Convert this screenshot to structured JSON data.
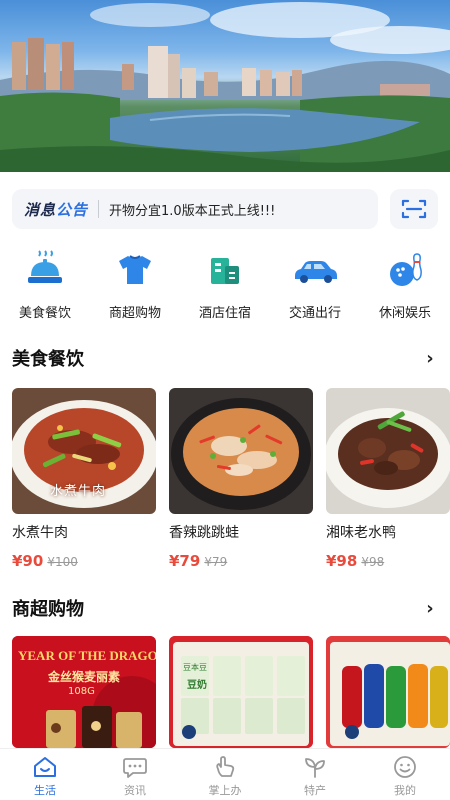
{
  "notice": {
    "tag_part1": "消息",
    "tag_part2": "公告",
    "text": "开物分宜1.0版本正式上线!!!"
  },
  "categories": [
    {
      "label": "美食餐饮",
      "icon": "food-cloche-icon"
    },
    {
      "label": "商超购物",
      "icon": "shirt-icon"
    },
    {
      "label": "酒店住宿",
      "icon": "hotel-icon"
    },
    {
      "label": "交通出行",
      "icon": "car-icon"
    },
    {
      "label": "休闲娱乐",
      "icon": "bowling-icon"
    }
  ],
  "food_section": {
    "title": "美食餐饮",
    "more": "›",
    "items": [
      {
        "name": "水煮牛肉",
        "price": "¥90",
        "old_price": "¥100",
        "photo_caption": "水煮牛肉"
      },
      {
        "name": "香辣跳跳蛙",
        "price": "¥79",
        "old_price": "¥79"
      },
      {
        "name": "湘味老水鸭",
        "price": "¥98",
        "old_price": "¥98"
      }
    ]
  },
  "shop_section": {
    "title": "商超购物",
    "more": "›",
    "items": [
      {
        "banner": "YEAR OF THE DRAGON",
        "product": "金丝猴麦丽素",
        "weight": "108G"
      },
      {
        "product": "豆奶",
        "label": "豆本豆"
      },
      {
        "product": "可乐饮料"
      }
    ]
  },
  "tabs": [
    {
      "label": "生活",
      "icon": "home-icon",
      "active": true
    },
    {
      "label": "资讯",
      "icon": "chat-bubble-icon",
      "active": false
    },
    {
      "label": "掌上办",
      "icon": "hand-icon",
      "active": false
    },
    {
      "label": "特产",
      "icon": "sprout-icon",
      "active": false
    },
    {
      "label": "我的",
      "icon": "smile-icon",
      "active": false
    }
  ],
  "colors": {
    "accent": "#2b6fe0",
    "price": "#e84b3c",
    "muted": "#999999"
  }
}
